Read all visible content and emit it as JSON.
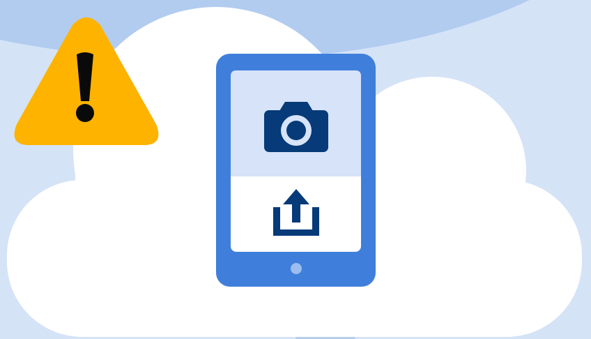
{
  "illustration": {
    "warning": {
      "icon": "warning-exclamation-icon",
      "color": "#fdb300",
      "mark_color": "#0a0a0a"
    },
    "cloud": {
      "icon": "cloud-icon",
      "color": "#ffffff"
    },
    "background": {
      "color": "#d5e3f7",
      "arc_color": "#b2ccf0"
    },
    "tablet": {
      "icon": "tablet-icon",
      "frame_color": "#3f7fdb",
      "screen_top_color": "#d6e3f8",
      "screen_bottom_color": "#ffffff",
      "home_button_color": "#9dbdf0",
      "camera": {
        "icon": "camera-icon",
        "color": "#063a78"
      },
      "upload": {
        "icon": "upload-icon",
        "color": "#063a78"
      }
    }
  }
}
